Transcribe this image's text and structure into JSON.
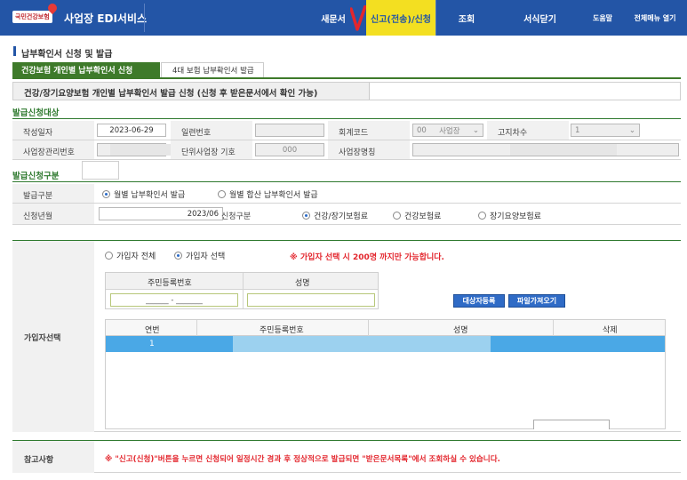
{
  "nav": {
    "logo_text": "국민건강보험",
    "brand": "사업장 EDI서비스",
    "menu_new": "새문서",
    "menu_report": "신고(전송)/신청",
    "menu_search": "조회",
    "menu_close": "서식닫기",
    "menu_help": "도움말",
    "menu_all": "전체메뉴 열기"
  },
  "page": {
    "title": "납부확인서 신청 및 발급",
    "tabs": [
      "건강보험 개인별 납부확인서 신청",
      "4대 보험 납부확인서 발급"
    ],
    "subheading": "건강/장기요양보험 개인별 납부확인서 발급 신청 (신청 후 받은문서에서 확인 가능)"
  },
  "target": {
    "section_title": "발급신청대상",
    "write_date_label": "작성일자",
    "write_date": "2023-06-29",
    "serial_label": "일련번호",
    "account_code_label": "회계코드",
    "account_code": "00",
    "account_code_name": "사업장",
    "notice_label": "고지차수",
    "notice_value": "1",
    "mgmt_no_label": "사업장관리번호",
    "unit_label": "단위사업장 기호",
    "unit_value": "000",
    "biz_name_label": "사업장명칭"
  },
  "category": {
    "section_title": "발급신청구분",
    "issue_type_label": "발급구분",
    "issue_monthly": "월별 납부확인서 발급",
    "issue_combined": "월별 합산 납부확인서 발급",
    "request_month_label": "신청년월",
    "request_month": "2023/06",
    "request_type_label": "신청구분",
    "type_health_ltc": "건강/장기보험료",
    "type_health": "건강보험료",
    "type_ltc": "장기요양보험료"
  },
  "subscriber": {
    "label": "가입자선택",
    "all": "가입자 전체",
    "select": "가입자 선택",
    "notice": "※ 가입자 선택 시 200명 까지만 가능합니다.",
    "id_header": "주민등록번호",
    "name_header": "성명",
    "id_placeholder": "______ - _______",
    "register_button": "대상자등록",
    "import_button": "파일가져오기",
    "columns": [
      "연번",
      "주민등록번호",
      "성명",
      "삭제"
    ],
    "rows": [
      {
        "no": "1"
      }
    ]
  },
  "reference": {
    "label": "참고사항",
    "text": "※ \"신고(신청)\"버튼을 누르면 신청되어 일정시간 경과 후 정상적으로 발급되면 \"받은문서목록\"에서 조회하실 수 있습니다."
  },
  "colors": {
    "nav_blue": "#2355a6",
    "tab_green": "#3e7a2a",
    "highlight_yellow": "#f3df21",
    "check_red": "#e3262d",
    "notice_red": "#e3262d",
    "selected_row": "#4aa8e6"
  }
}
